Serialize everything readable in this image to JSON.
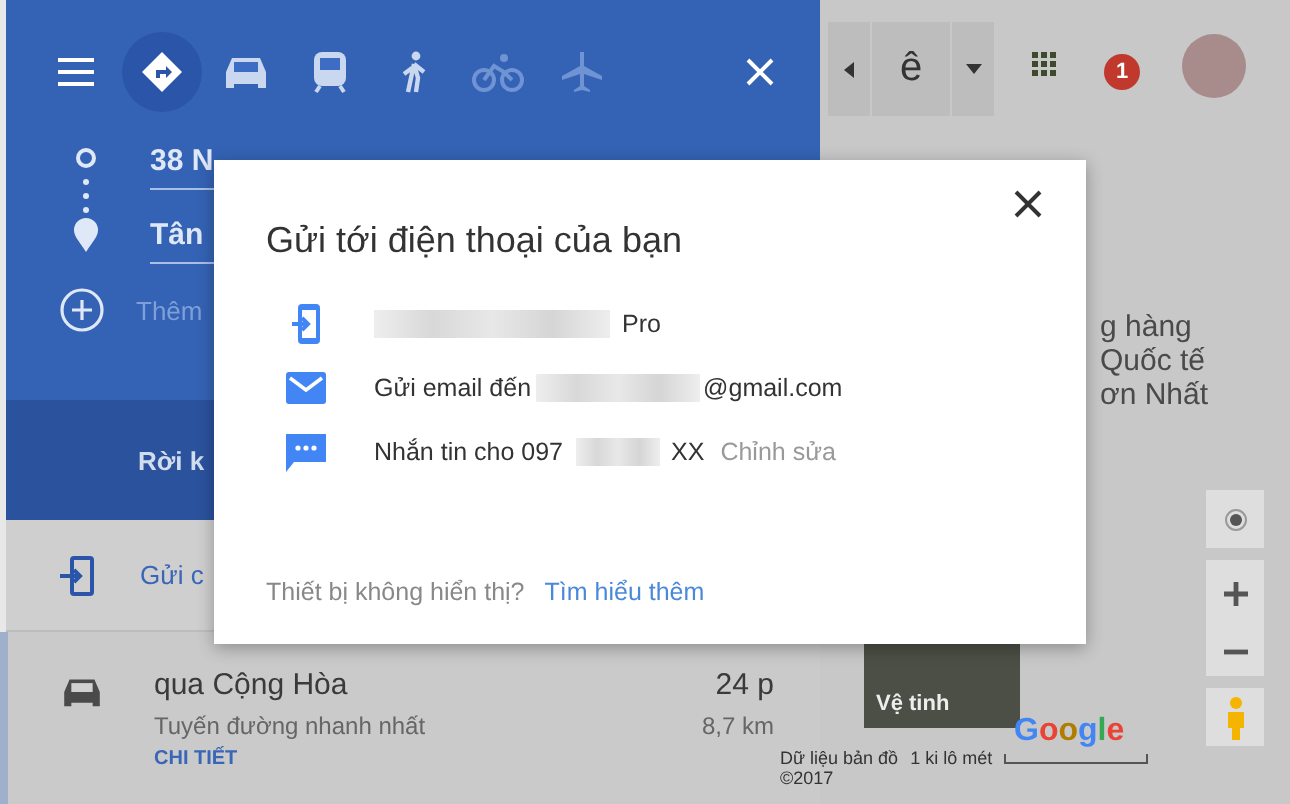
{
  "toolbar": {
    "modes": [
      {
        "kind": "directions",
        "selected": true,
        "disabled": false
      },
      {
        "kind": "car",
        "selected": false,
        "disabled": false
      },
      {
        "kind": "transit",
        "selected": false,
        "disabled": false
      },
      {
        "kind": "walk",
        "selected": false,
        "disabled": false
      },
      {
        "kind": "bike",
        "selected": false,
        "disabled": true
      },
      {
        "kind": "plane",
        "selected": false,
        "disabled": true
      }
    ]
  },
  "route_inputs": {
    "origin": "38 N",
    "destination": "Tân",
    "add_placeholder": "Thêm"
  },
  "depart_label": "Rời k",
  "send_label": "Gửi c",
  "route": {
    "name": "qua Cộng Hòa",
    "duration": "24 p",
    "note": "Tuyến đường nhanh nhất",
    "distance": "8,7 km",
    "details_link": "CHI TIẾT"
  },
  "map": {
    "language_label": "ê",
    "notification_count": "1",
    "labels": [
      "g hàng",
      "Quốc tế",
      "ơn Nhất"
    ],
    "satellite_label": "Vệ tinh",
    "logo": "Google",
    "attribution": "Dữ liệu bản đồ",
    "copyright": "©2017",
    "scale": "1 ki lô mét"
  },
  "dialog": {
    "title": "Gửi tới điện thoại của bạn",
    "options": [
      {
        "kind": "device",
        "redacted": true,
        "suffix": "Pro"
      },
      {
        "kind": "email",
        "prefix": "Gửi email đến",
        "redacted": true,
        "suffix": "@gmail.com"
      },
      {
        "kind": "sms",
        "prefix": "Nhắn tin cho 097",
        "redacted": true,
        "suffix": "XX",
        "action": "Chỉnh sửa"
      }
    ],
    "footer_question": "Thiết bị không hiển thị?",
    "footer_link": "Tìm hiểu thêm"
  }
}
